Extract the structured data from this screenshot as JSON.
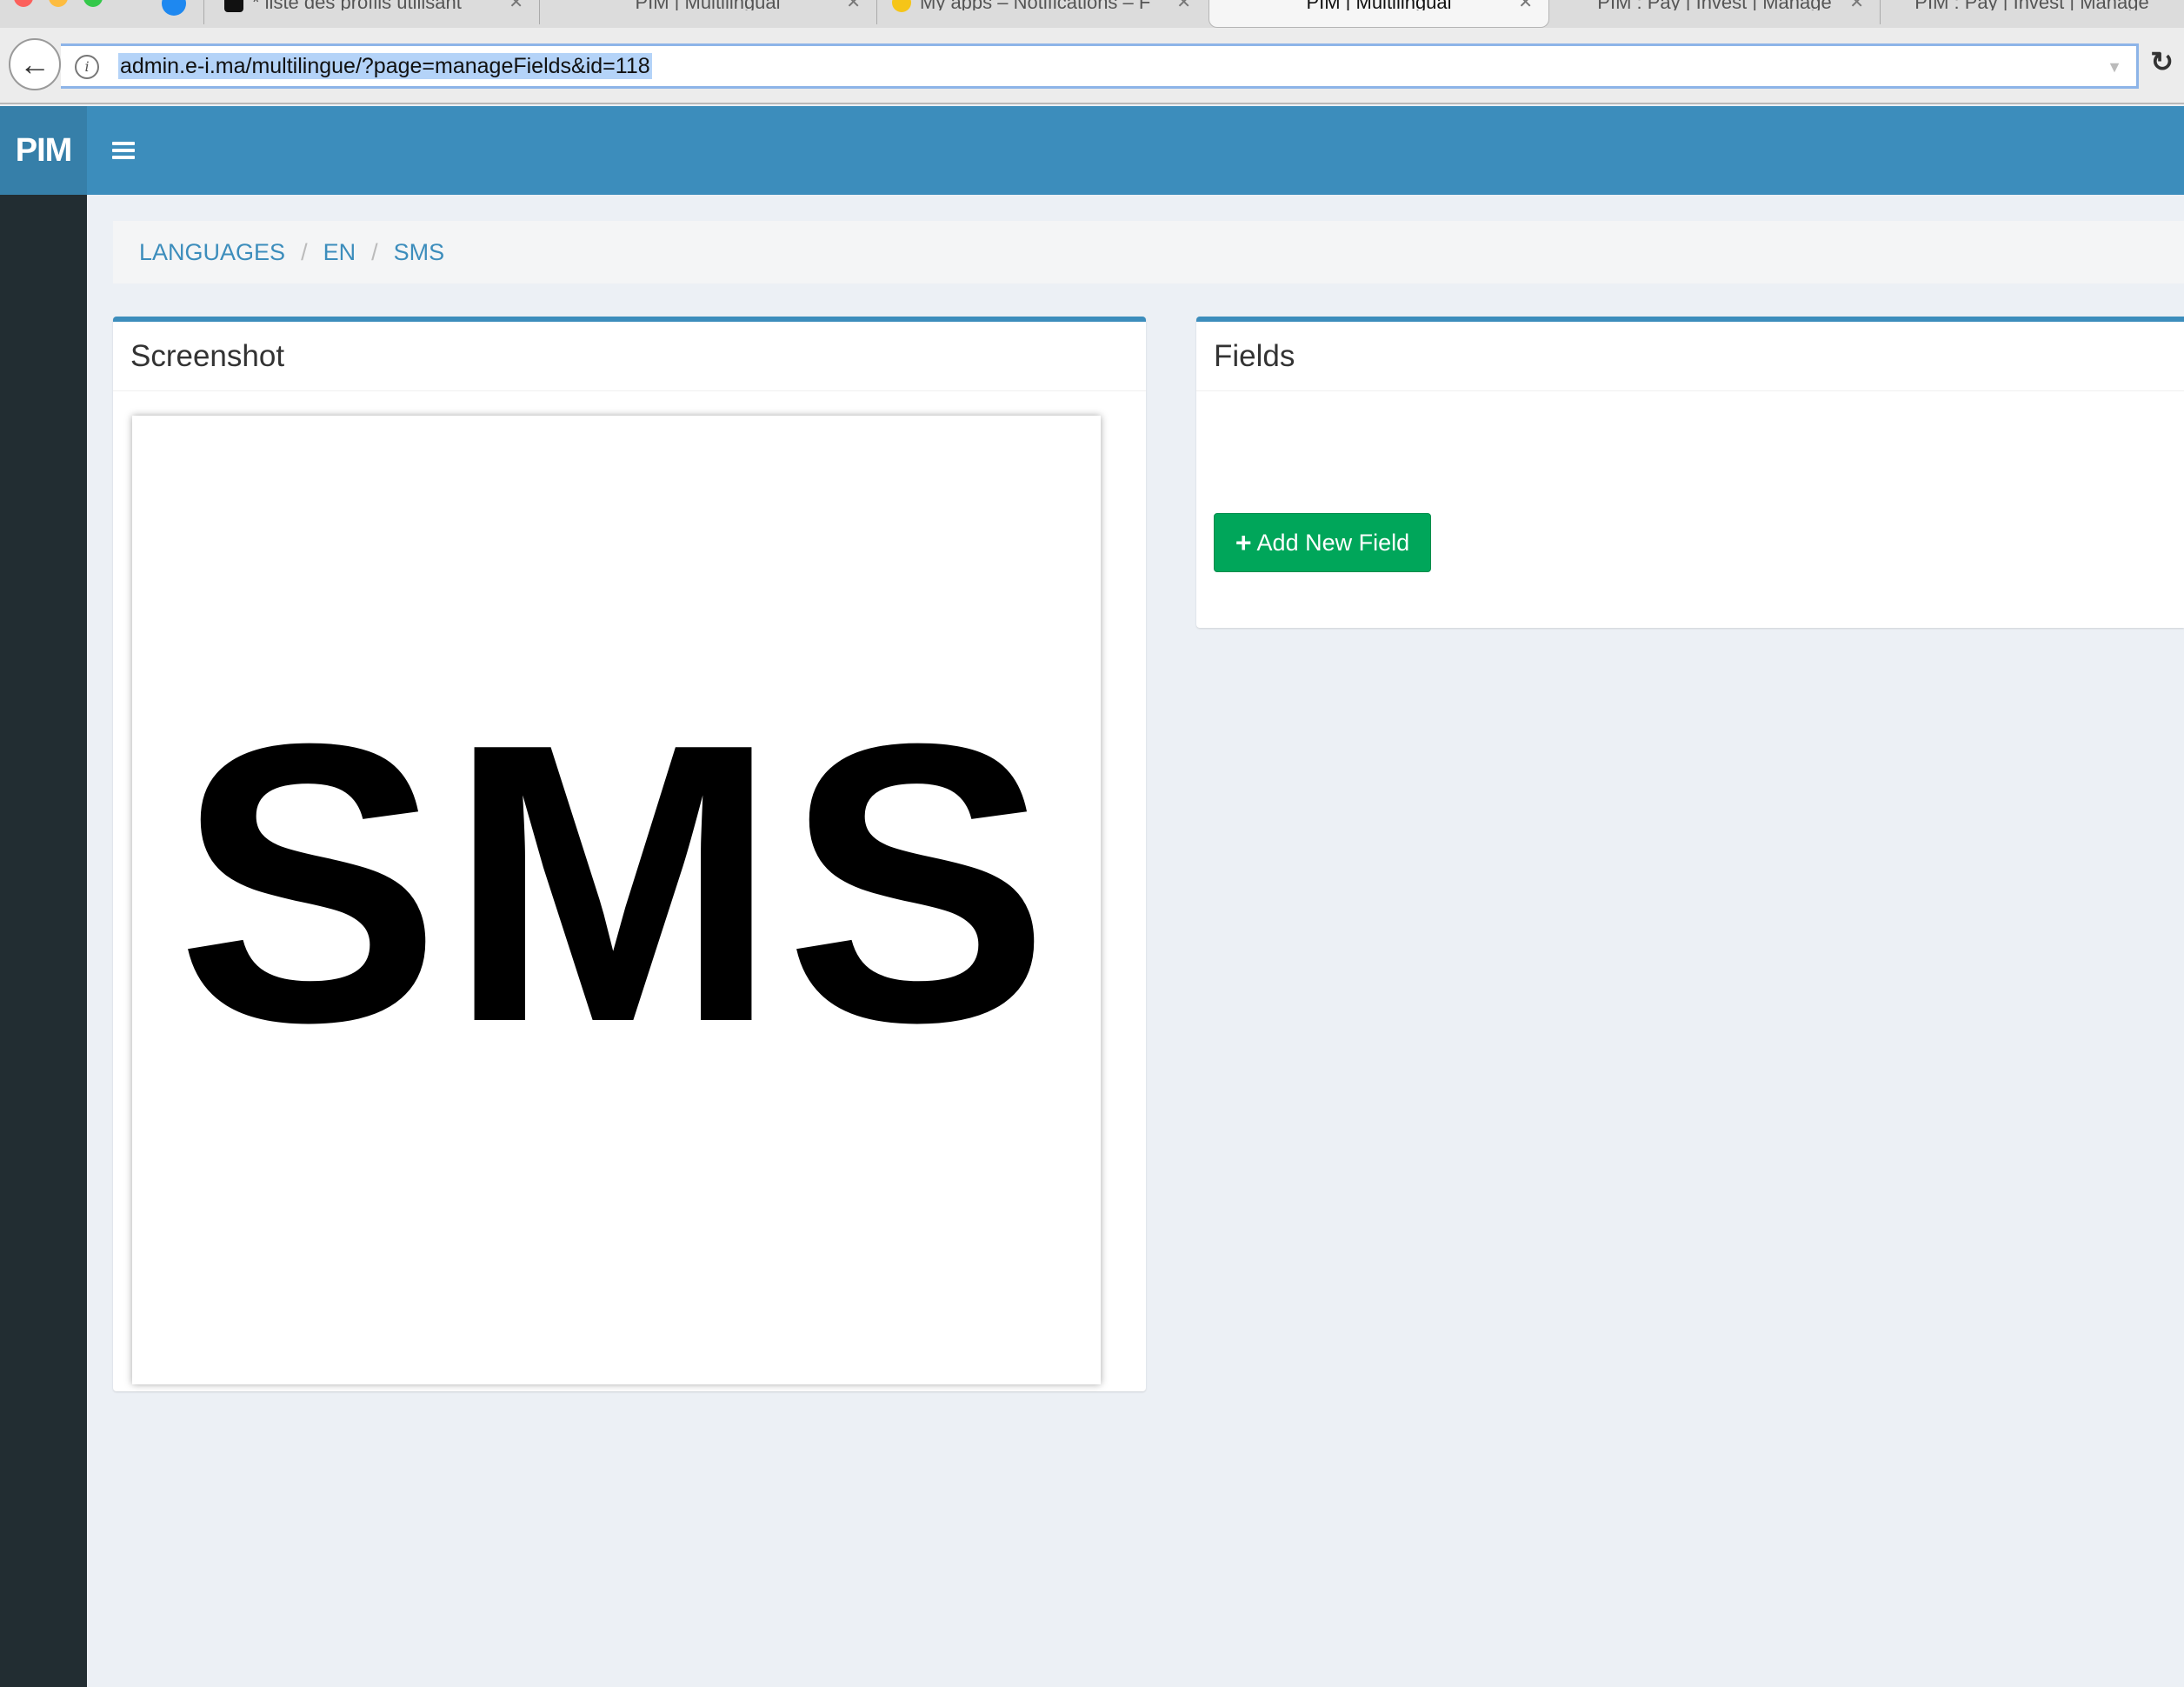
{
  "browser": {
    "tabs": [
      {
        "title": "* liste des profils utilisant",
        "close": "✕"
      },
      {
        "title": "PIM | Multilingual",
        "close": "✕"
      },
      {
        "title": "My apps – Notifications – F",
        "close": "✕"
      },
      {
        "title": "PIM | Multilingual",
        "close": "✕"
      },
      {
        "title": "PIM : Pay | Invest | Manage",
        "close": "✕"
      },
      {
        "title": "PIM : Pay | Invest | Manage",
        "close": ""
      }
    ],
    "url": "admin.e-i.ma/multilingue/?page=manageFields&id=118"
  },
  "app": {
    "logo": "PIM",
    "colors": {
      "header": "#3c8dbc",
      "logo_bg": "#367fa9",
      "sidebar": "#222d32",
      "success": "#00a65a"
    }
  },
  "breadcrumb": {
    "items": [
      "LANGUAGES",
      "EN",
      "SMS"
    ]
  },
  "screenshot_panel": {
    "title": "Screenshot",
    "image_text": "SMS"
  },
  "fields_panel": {
    "title": "Fields",
    "add_button_label": "Add New Field",
    "add_button_icon": "plus-icon"
  }
}
